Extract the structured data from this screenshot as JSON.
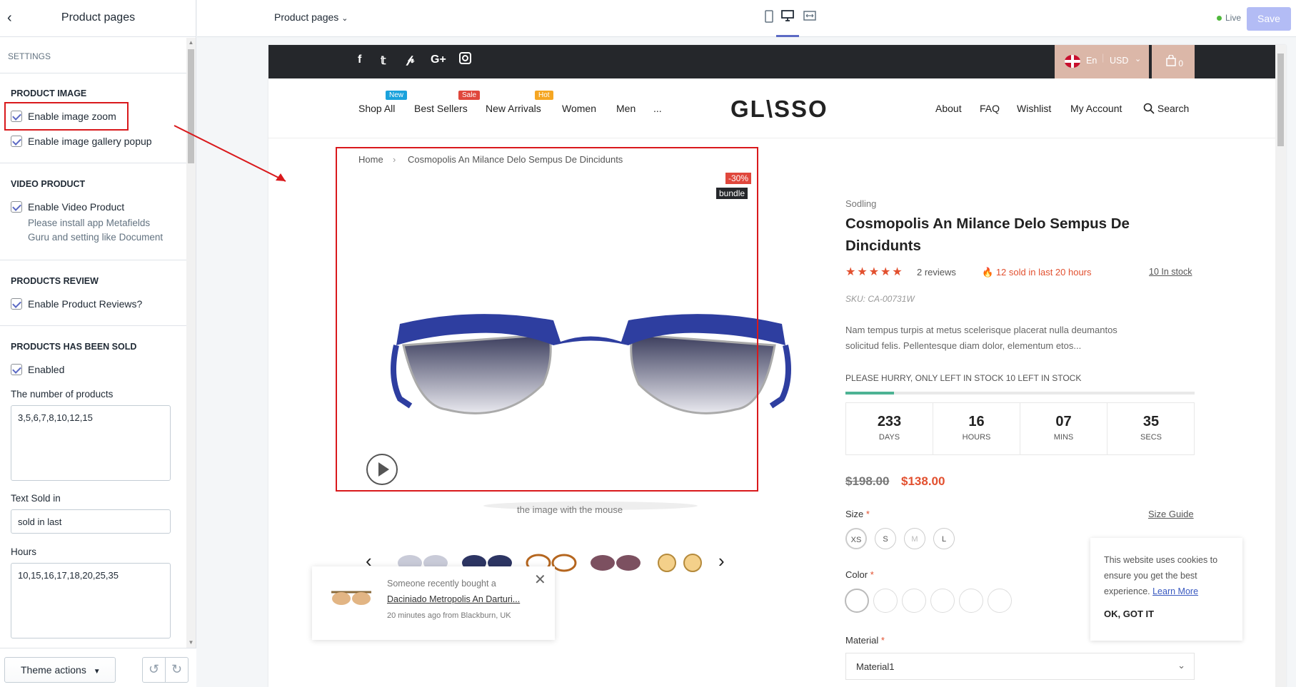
{
  "sidebar": {
    "title": "Product pages",
    "settings_label": "SETTINGS",
    "product_image": {
      "heading": "PRODUCT IMAGE",
      "zoom": "Enable image zoom",
      "gallery": "Enable image gallery popup"
    },
    "video": {
      "heading": "VIDEO PRODUCT",
      "enable": "Enable Video Product",
      "hint_1": "Please install app Metafields",
      "hint_2": "Guru and setting like Document"
    },
    "review": {
      "heading": "PRODUCTS REVIEW",
      "enable": "Enable Product Reviews?"
    },
    "sold": {
      "heading": "PRODUCTS HAS BEEN SOLD",
      "enabled": "Enabled",
      "number_label": "The number of products",
      "number_value": "3,5,6,7,8,10,12,15",
      "text_label": "Text Sold in",
      "text_value": "sold in last",
      "hours_label": "Hours",
      "hours_value": "10,15,16,17,18,20,25,35"
    },
    "theme_actions": "Theme actions"
  },
  "topbar": {
    "page_select": "Product pages",
    "live": "Live",
    "save": "Save"
  },
  "store": {
    "lang": "En",
    "currency": "USD",
    "cart_count": "0",
    "logo": "GL\\SSO",
    "nav_left": [
      "Shop All",
      "Best Sellers",
      "New Arrivals",
      "Women",
      "Men",
      "..."
    ],
    "badges": {
      "new": "New",
      "sale": "Sale",
      "hot": "Hot"
    },
    "nav_right": [
      "About",
      "FAQ",
      "Wishlist",
      "My Account",
      "Search"
    ],
    "breadcrumb_home": "Home",
    "breadcrumb_current": "Cosmopolis An Milance Delo Sempus De Dincidunts",
    "discount": "-30%",
    "bundle": "bundle",
    "zoom_hint": "the image with the mouse",
    "popup": {
      "line1": "Someone recently bought a",
      "line2": "Daciniado Metropolis An Darturi...",
      "line3": "20 minutes ago from Blackburn, UK"
    }
  },
  "product": {
    "vendor": "Sodling",
    "title": "Cosmopolis An Milance Delo Sempus De Dincidunts",
    "stars": "★★★★★",
    "reviews": "2 reviews",
    "sold": "12 sold in last 20 hours",
    "in_stock": "10 In stock",
    "sku": "SKU: CA-00731W",
    "desc": "Nam tempus turpis at metus scelerisque placerat nulla deumantos solicitud felis. Pellentesque diam dolor, elementum etos...",
    "hurry": "PLEASE HURRY, ONLY LEFT IN STOCK 10 LEFT IN STOCK",
    "stock_fraction": 0.14,
    "countdown": [
      {
        "num": "233",
        "label": "DAYS"
      },
      {
        "num": "16",
        "label": "HOURS"
      },
      {
        "num": "07",
        "label": "MINS"
      },
      {
        "num": "35",
        "label": "SECS"
      }
    ],
    "price_old": "$198.00",
    "price_new": "$138.00",
    "size_label": "Size",
    "size_guide": "Size Guide",
    "sizes": [
      "XS",
      "S",
      "M",
      "L"
    ],
    "color_label": "Color",
    "material_label": "Material",
    "material_value": "Material1"
  },
  "cookie": {
    "text": "This website uses cookies to ensure you get the best experience.",
    "link": "Learn More",
    "button": "OK, GOT IT"
  }
}
